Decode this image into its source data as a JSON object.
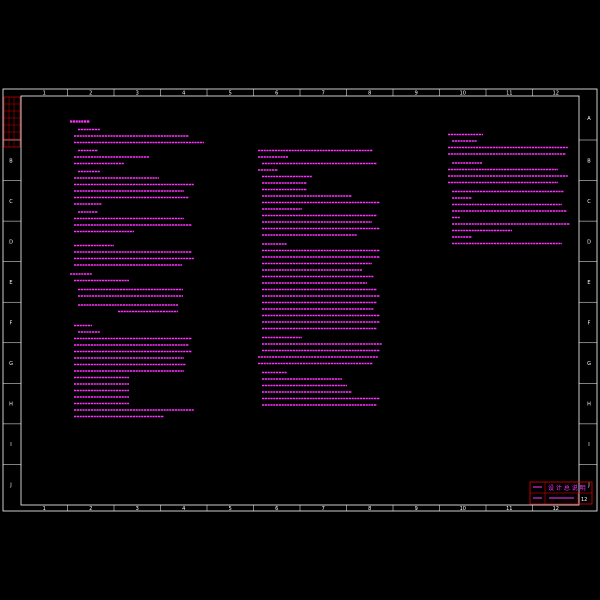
{
  "drawing": {
    "colors": {
      "background": "#000000",
      "frame": "#ffffff",
      "text": "#ff33ff",
      "accent": "#ff0000"
    },
    "column_labels_top": [
      "1",
      "2",
      "3",
      "4",
      "5",
      "6",
      "7",
      "8",
      "9",
      "10",
      "11",
      "12"
    ],
    "column_labels_bottom": [
      "1",
      "2",
      "3",
      "4",
      "5",
      "6",
      "7",
      "8",
      "9",
      "10",
      "11",
      "12"
    ],
    "row_labels_left": [
      "A",
      "B",
      "C",
      "D",
      "E",
      "F",
      "G",
      "H",
      "I",
      "J"
    ],
    "row_labels_right": [
      "A",
      "B",
      "C",
      "D",
      "E",
      "F",
      "G",
      "H",
      "I",
      "J"
    ],
    "title_block": {
      "title": "设 计 总 说 明",
      "drawing_no": "12"
    },
    "notes_note": "Note text in the drawing is rendered as illegibly small CAD lines; represented as text-line strokes."
  }
}
